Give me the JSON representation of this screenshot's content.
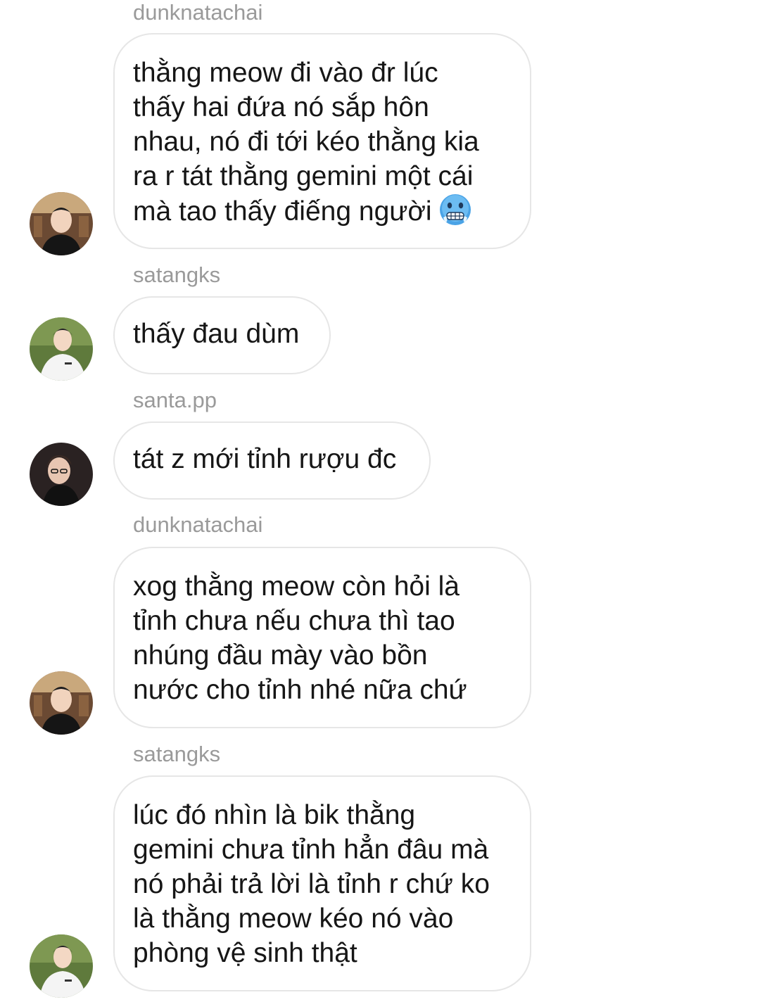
{
  "messages": [
    {
      "sender": "dunknatachai",
      "text": "thằng meow đi vào đr lúc\nthấy hai đứa nó sắp hôn\nnhau, nó đi tới kéo thằng kia\nra r tát thằng gemini một cái\nmà tao thấy điếng người",
      "emoji": "cold-face-icon",
      "avatar": "avatar-dunknatachai"
    },
    {
      "sender": "satangks",
      "text": "thấy đau dùm",
      "avatar": "avatar-satangks"
    },
    {
      "sender": "santa.pp",
      "text": "tát z mới tỉnh rượu đc",
      "avatar": "avatar-santa-pp"
    },
    {
      "sender": "dunknatachai",
      "text": "xog thằng meow còn hỏi là\ntỉnh chưa nếu chưa thì tao\nnhúng đầu mày vào bồn\nnước cho tỉnh nhé nữa chứ",
      "avatar": "avatar-dunknatachai"
    },
    {
      "sender": "satangks",
      "text": "lúc đó nhìn là bik thằng\ngemini chưa tỉnh hẳn đâu mà\nnó phải trả lời là tỉnh r chứ ko\nlà thằng meow kéo nó vào\nphòng vệ sinh thật",
      "avatar": "avatar-satangks"
    }
  ],
  "colors": {
    "bubble_border": "#e6e6e6",
    "sender_text": "#9a9a9a",
    "message_text": "#161616"
  }
}
